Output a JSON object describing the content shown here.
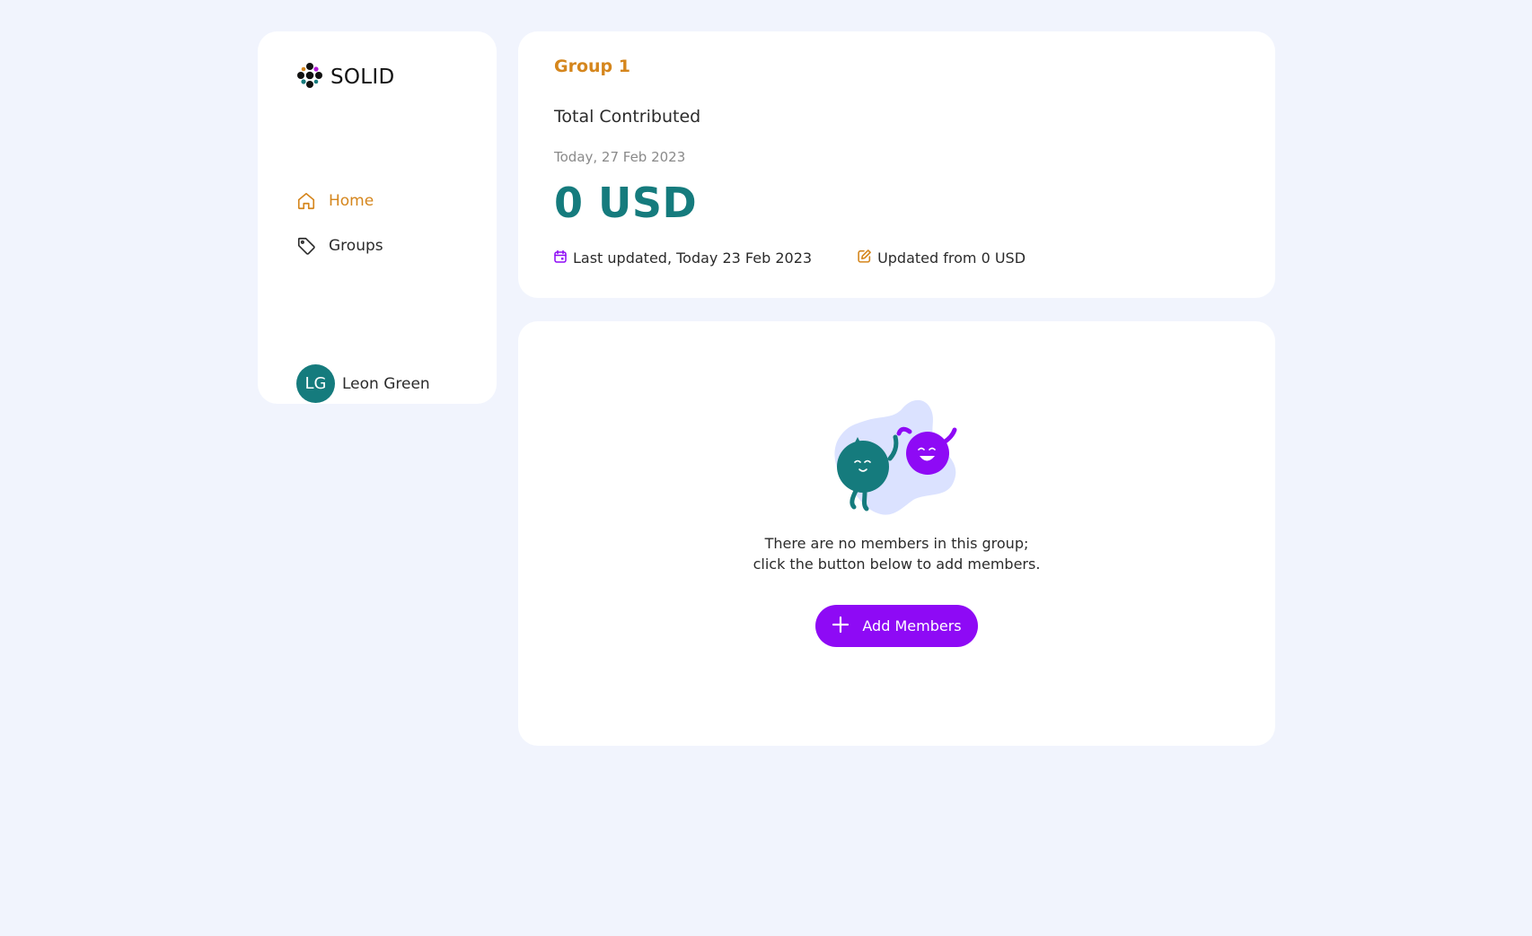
{
  "brand": {
    "name": "SOLID"
  },
  "sidebar": {
    "items": [
      {
        "label": "Home",
        "icon": "home-icon",
        "active": true
      },
      {
        "label": "Groups",
        "icon": "tag-icon",
        "active": false
      }
    ]
  },
  "user": {
    "initials": "LG",
    "name": "Leon Green"
  },
  "summary": {
    "group_title": "Group 1",
    "total_label": "Total Contributed",
    "date": "Today, 27 Feb 2023",
    "amount": "0 USD",
    "last_updated": "Last updated, Today 23 Feb 2023",
    "updated_from": "Updated from 0 USD"
  },
  "members": {
    "empty_line1": "There are no members in this group;",
    "empty_line2": "click the button below to add members.",
    "add_button_label": "Add Members"
  },
  "colors": {
    "accent_orange": "#d5861d",
    "teal": "#157b7d",
    "purple": "#8e0af5",
    "background": "#f1f4fd"
  }
}
